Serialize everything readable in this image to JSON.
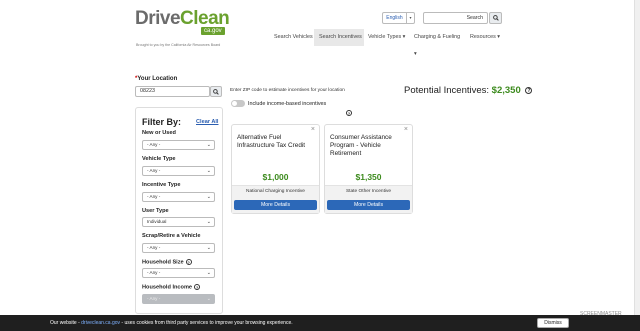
{
  "header": {
    "logo_drive": "Drive",
    "logo_clean": "Clean",
    "logo_badge": "ca.gov",
    "logo_tagline": "Brought to you by the California Air Resources Board",
    "language": "English",
    "search_placeholder": "Search",
    "nav": [
      {
        "label": "Search Vehicles"
      },
      {
        "label": "Search Incentives"
      },
      {
        "label": "Vehicle Types ▾"
      },
      {
        "label": "Charging & Fueling ▾"
      },
      {
        "label": "Resources ▾"
      }
    ]
  },
  "location": {
    "label": "Your Location",
    "zip_value": "08223",
    "hint": "Enter ZIP code to estimate incentives for your location"
  },
  "filters": {
    "title": "Filter By:",
    "clear_label": "Clear All",
    "groups": [
      {
        "label": "New or Used",
        "value": "- Any -"
      },
      {
        "label": "Vehicle Type",
        "value": "- Any -"
      },
      {
        "label": "Incentive Type",
        "value": "- Any -"
      },
      {
        "label": "User Type",
        "value": "Individual"
      },
      {
        "label": "Scrap/Retire a Vehicle",
        "value": "- Any -"
      },
      {
        "label": "Household Size",
        "value": "- Any -"
      },
      {
        "label": "Household Income",
        "value": "- Any -"
      }
    ]
  },
  "income_toggle": {
    "label": "Include income-based incentives"
  },
  "potential": {
    "label": "Potential Incentives:",
    "amount": "$2,350"
  },
  "cards": [
    {
      "title": "Alternative Fuel Infrastructure Tax Credit",
      "amount": "$1,000",
      "type": "National Charging Incentive",
      "button": "More Details"
    },
    {
      "title": "Consumer Assistance Program - Vehicle Retirement",
      "amount": "$1,350",
      "type": "State Other Incentive",
      "button": "More Details"
    }
  ],
  "cookie": {
    "prefix": "Our website - ",
    "site": "driveclean.ca.gov",
    "suffix": " - uses cookies from third party services to improve your browsing experience.",
    "dismiss": "Dismiss"
  },
  "watermark": "SCREENMASTER"
}
